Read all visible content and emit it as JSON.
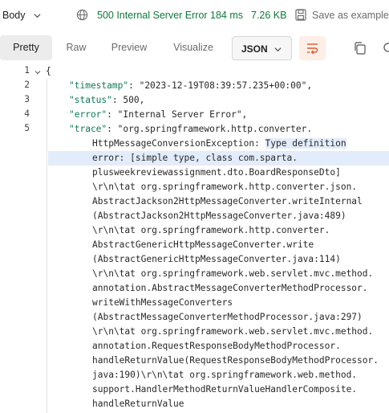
{
  "response_bar": {
    "body_tab": "Body",
    "status": "500 Internal Server Error",
    "time": "184 ms",
    "size": "7.26 KB",
    "save_label": "Save as example"
  },
  "view_tabs": [
    {
      "label": "Pretty",
      "active": true
    },
    {
      "label": "Raw",
      "active": false
    },
    {
      "label": "Preview",
      "active": false
    },
    {
      "label": "Visualize",
      "active": false
    }
  ],
  "format_select": "JSON",
  "colors": {
    "status_ok": "#0c7b3b",
    "wrap_accent": "#e05a2a",
    "highlight": "#e3ecfa",
    "key": "#0e7a53"
  },
  "icons": [
    "chevron-down-icon",
    "globe-icon",
    "save-icon",
    "wrap-lines-icon",
    "copy-icon",
    "search-icon"
  ],
  "code": {
    "line_numbers": [
      "1",
      "2",
      "3",
      "4",
      "5"
    ],
    "open_brace": "{",
    "timestamp": {
      "key": "\"timestamp\"",
      "value": "\"2023-12-19T08:39:57.235+00:00\","
    },
    "status": {
      "key": "\"status\"",
      "value": "500,"
    },
    "error": {
      "key": "\"error\"",
      "value": "\"Internal Server Error\","
    },
    "trace": {
      "key": "\"trace\"",
      "first": "\"org.springframework.http.converter.",
      "l2a": "HttpMessageConversionException: ",
      "l2b": "Type definition",
      "l3": "error: [simple type, class com.sparta.",
      "l4": "plusweekreviewassignment.dto.BoardResponseDto]",
      "lines": [
        "\\r\\n\\tat org.springframework.http.converter.json.",
        "AbstractJackson2HttpMessageConverter.writeInternal",
        "(AbstractJackson2HttpMessageConverter.java:489)",
        "\\r\\n\\tat org.springframework.http.converter.",
        "AbstractGenericHttpMessageConverter.write",
        "(AbstractGenericHttpMessageConverter.java:114)",
        "\\r\\n\\tat org.springframework.web.servlet.mvc.method.",
        "annotation.AbstractMessageConverterMethodProcessor.",
        "writeWithMessageConverters",
        "(AbstractMessageConverterMethodProcessor.java:297)",
        "\\r\\n\\tat org.springframework.web.servlet.mvc.method.",
        "annotation.RequestResponseBodyMethodProcessor.",
        "handleReturnValue(RequestResponseBodyMethodProcessor.",
        "java:190)\\r\\n\\tat org.springframework.web.method.",
        "support.HandlerMethodReturnValueHandlerComposite.",
        "handleReturnValue"
      ]
    }
  }
}
